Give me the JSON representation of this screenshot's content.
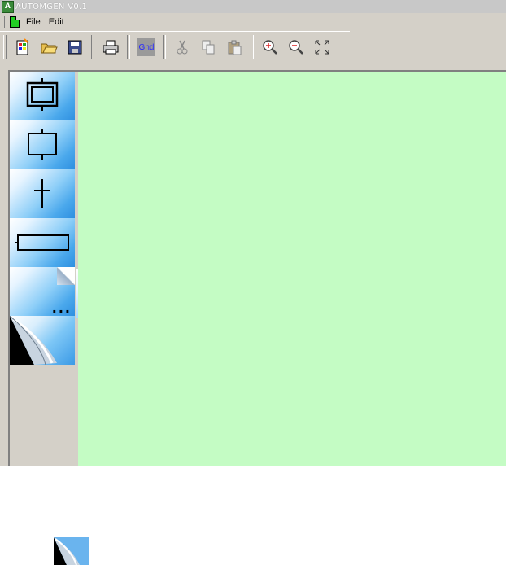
{
  "window": {
    "title": "AUTOMGEN V0.1",
    "app_icon_letter": "A"
  },
  "menu": {
    "items": [
      "File",
      "Edit"
    ]
  },
  "toolbar": {
    "buttons": [
      "new-icon",
      "open-icon",
      "save-icon",
      "print-icon",
      "gnd-icon",
      "cut-icon",
      "copy-icon",
      "paste-icon",
      "zoom-in-icon",
      "zoom-out-icon",
      "fit-icon"
    ],
    "gnd_label": "Gnd"
  },
  "sidebar": {
    "tools": [
      "initial-step",
      "step",
      "transition",
      "action-box",
      "more",
      "page-curl"
    ],
    "more_label": "..."
  },
  "flyout": {
    "tools": [
      "divergence-and",
      "convergence-and",
      "divergence-or",
      "convergence-or",
      "more"
    ],
    "more_label": "..."
  },
  "colors": {
    "canvas": "#c4fcc4",
    "chrome": "#d4d0c8",
    "tile_light": "#e6f4ff",
    "tile_dark": "#2e8fe0"
  }
}
